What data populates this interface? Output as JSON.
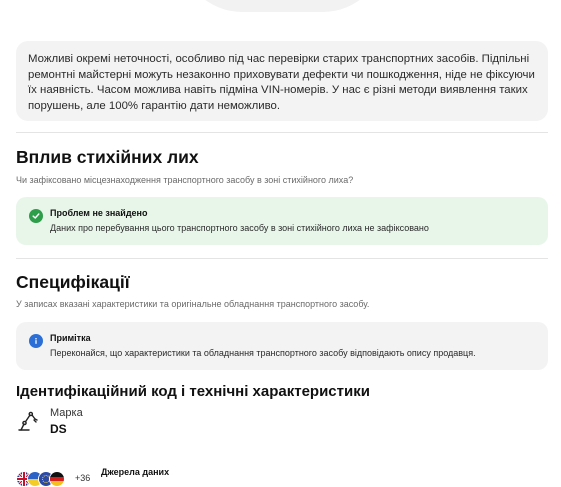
{
  "notice": {
    "text": "Можливі окремі неточності, особливо під час перевірки старих транспортних засобів. Підпільні ремонтні майстерні можуть незаконно приховувати дефекти чи пошкодження, ніде не фіксуючи їх наявність. Часом можлива навіть підміна VIN-номерів. У нас є різні методи виявлення таких порушень, але 100% гарантію дати неможливо."
  },
  "disaster": {
    "title": "Вплив стихійних лих",
    "subtitle": "Чи зафіксовано місцезнаходження транспортного засобу в зоні стихійного лиха?",
    "status_title": "Проблем не знайдено",
    "status_text": "Даних про перебування цього транспортного засобу в зоні стихійного лиха не зафіксовано",
    "status_icon": "check-circle-icon",
    "status_color": "#2e9e4a"
  },
  "specs": {
    "title": "Специфікації",
    "subtitle": "У записах вказані характеристики та оригінальне обладнання транспортного засобу.",
    "note_title": "Примітка",
    "note_text": "Переконайся, що характеристики та обладнання транспортного засобу відповідають опису продавця.",
    "note_icon": "info-circle-icon",
    "note_color": "#2b6fd6"
  },
  "identification": {
    "title": "Ідентифікаційний код і технічні характеристики",
    "make_label": "Марка",
    "make_value": "DS",
    "make_icon": "robot-arm-icon"
  },
  "sources": {
    "count": "+36",
    "label": "Джерела даних",
    "flags": [
      "uk-flag",
      "ukraine-flag",
      "eu-flag",
      "germany-flag"
    ]
  }
}
